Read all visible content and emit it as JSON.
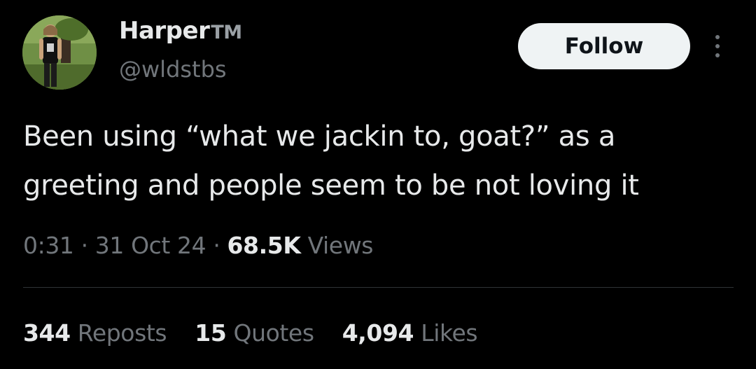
{
  "author": {
    "display_name": "Harper",
    "badge": "TM",
    "handle": "@wldstbs"
  },
  "follow_label": "Follow",
  "tweet": {
    "text_line1": "Been using “what we jackin to, goat?” as a",
    "text_line2": "greeting and people seem to be not loving it"
  },
  "meta": {
    "time": "0:31",
    "separator": "·",
    "date": "31 Oct 24",
    "views_count": "68.5K",
    "views_label": "Views"
  },
  "stats": {
    "reposts_count": "344",
    "reposts_label": "Reposts",
    "quotes_count": "15",
    "quotes_label": "Quotes",
    "likes_count": "4,094",
    "likes_label": "Likes"
  },
  "icons": {
    "avatar": "avatar-photo",
    "more": "more-vertical-icon"
  },
  "colors": {
    "background": "#000000",
    "primary_text": "#e7e9ea",
    "secondary_text": "#71767b",
    "follow_bg": "#eff3f4",
    "follow_text": "#0f1419",
    "divider": "#2f3336"
  }
}
